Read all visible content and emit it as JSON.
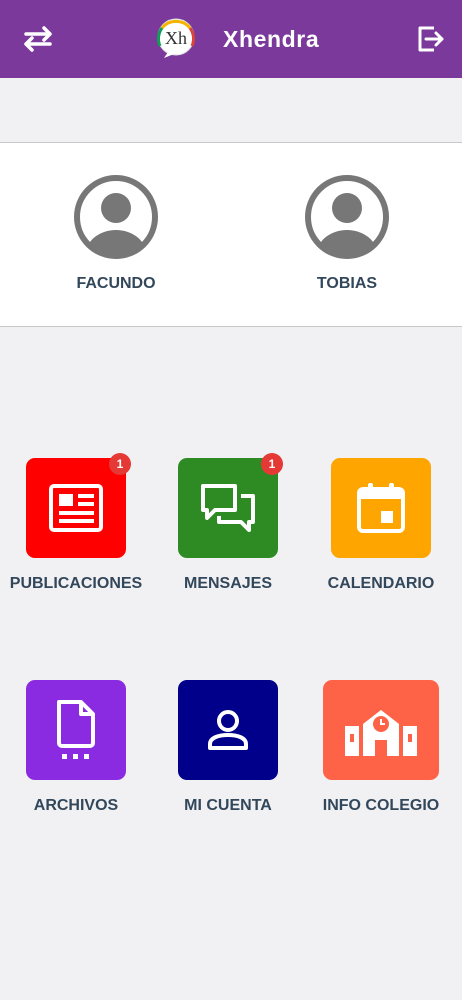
{
  "app": {
    "title": "Xhendra",
    "logo_text": "Xh",
    "brand_color": "#7b3a9b"
  },
  "toolbar": {
    "switch_icon": "swap-arrows-icon",
    "logout_icon": "logout-icon"
  },
  "children": [
    {
      "name": "FACUNDO",
      "icon": "avatar-icon"
    },
    {
      "name": "TOBIAS",
      "icon": "avatar-icon"
    }
  ],
  "menu": [
    {
      "label": "PUBLICACIONES",
      "icon": "newspaper-icon",
      "color": "#ff0000",
      "badge": "1"
    },
    {
      "label": "MENSAJES",
      "icon": "chat-icon",
      "color": "#2e8b24",
      "badge": "1"
    },
    {
      "label": "CALENDARIO",
      "icon": "calendar-icon",
      "color": "#ffa500",
      "badge": ""
    },
    {
      "label": "ARCHIVOS",
      "icon": "file-icon",
      "color": "#8a2be2",
      "badge": ""
    },
    {
      "label": "MI CUENTA",
      "icon": "user-icon",
      "color": "#00008b",
      "badge": ""
    },
    {
      "label": "INFO COLEGIO",
      "icon": "school-icon",
      "color": "#ff6347",
      "badge": ""
    }
  ]
}
